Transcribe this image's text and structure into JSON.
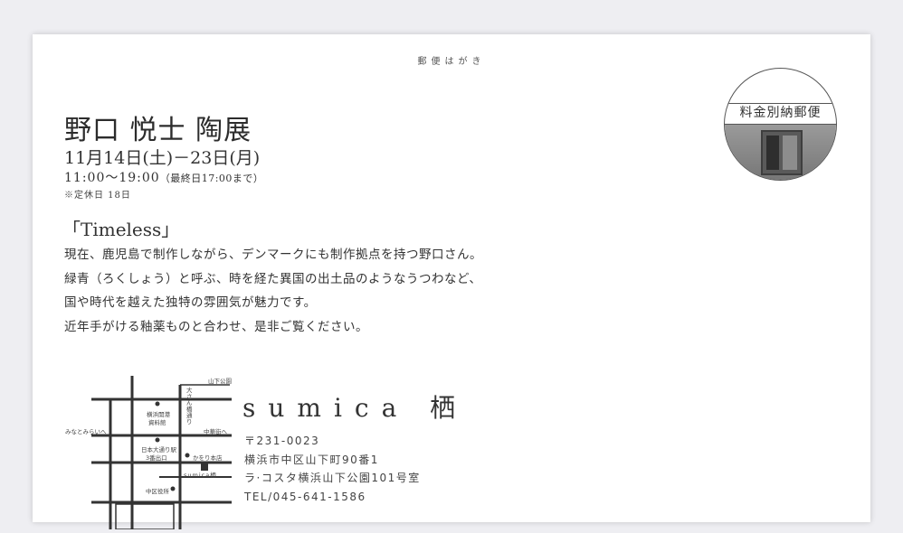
{
  "postcard_label": "郵便はがき",
  "stamp": {
    "text": "料金別納郵便"
  },
  "exhibition": {
    "title": "野口 悦士 陶展",
    "dates": "11月14日(土)－23日(月)",
    "hours": "11:00～19:00",
    "hours_note": "（最終日17:00まで）",
    "closed": "※定休日 18日",
    "subtitle": "「Timeless」",
    "description": [
      "現在、鹿児島で制作しながら、デンマークにも制作拠点を持つ野口さん。",
      "緑青（ろくしょう）と呼ぶ、時を経た異国の出土品のようなうつわなど、",
      "国や時代を越えた独特の雰囲気が魅力です。",
      "近年手がける釉薬ものと合わせ、是非ご覧ください。"
    ]
  },
  "map": {
    "labels": {
      "yamashita_park": "山下公園",
      "archives_line1": "横浜開港",
      "archives_line2": "資料館",
      "osanbashi": "大さん橋通り",
      "minatomirai": "みなとみらいへ",
      "chukagai": "中華街へ",
      "station_line1": "日本大通り駅",
      "station_line2": "3番出口",
      "kamori": "かをり本店",
      "sumica": "sumica栖",
      "ward_office": "中区役所"
    }
  },
  "shop": {
    "name": "sumica 栖",
    "postal": "〒231-0023",
    "address1": "横浜市中区山下町90番1",
    "address2": "ラ·コスタ横浜山下公園101号室",
    "tel": "TEL/045-641-1586"
  }
}
